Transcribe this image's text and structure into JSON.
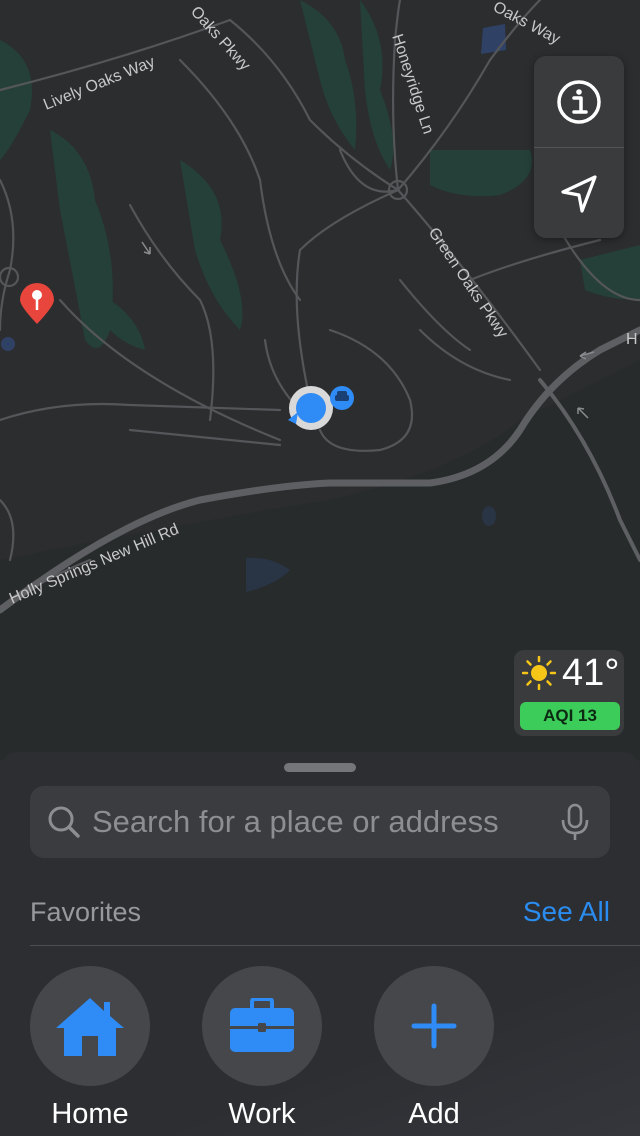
{
  "map": {
    "roads": [
      "Lively Oaks Way",
      "Oaks Pkwy",
      "Honeyridge Ln",
      "Oaks Way",
      "Green Oaks Pkwy",
      "Holly Springs New Hill Rd",
      "H"
    ],
    "controls": {
      "info_icon": "info-icon",
      "location_icon": "location-arrow-icon"
    },
    "weather": {
      "icon": "sun-icon",
      "temperature": "41°",
      "aqi": "AQI 13"
    }
  },
  "sheet": {
    "search": {
      "placeholder": "Search for a place or address",
      "mic_icon": "microphone-icon"
    },
    "favorites": {
      "title": "Favorites",
      "see_all": "See All",
      "items": [
        {
          "label": "Home",
          "icon": "house-icon"
        },
        {
          "label": "Work",
          "icon": "briefcase-icon"
        },
        {
          "label": "Add",
          "icon": "plus-icon"
        }
      ]
    }
  },
  "colors": {
    "accent": "#2b8cf0",
    "aqi_good": "#3ccc5a",
    "pin": "#e8453c",
    "map_bg": "#2b2d2f"
  }
}
